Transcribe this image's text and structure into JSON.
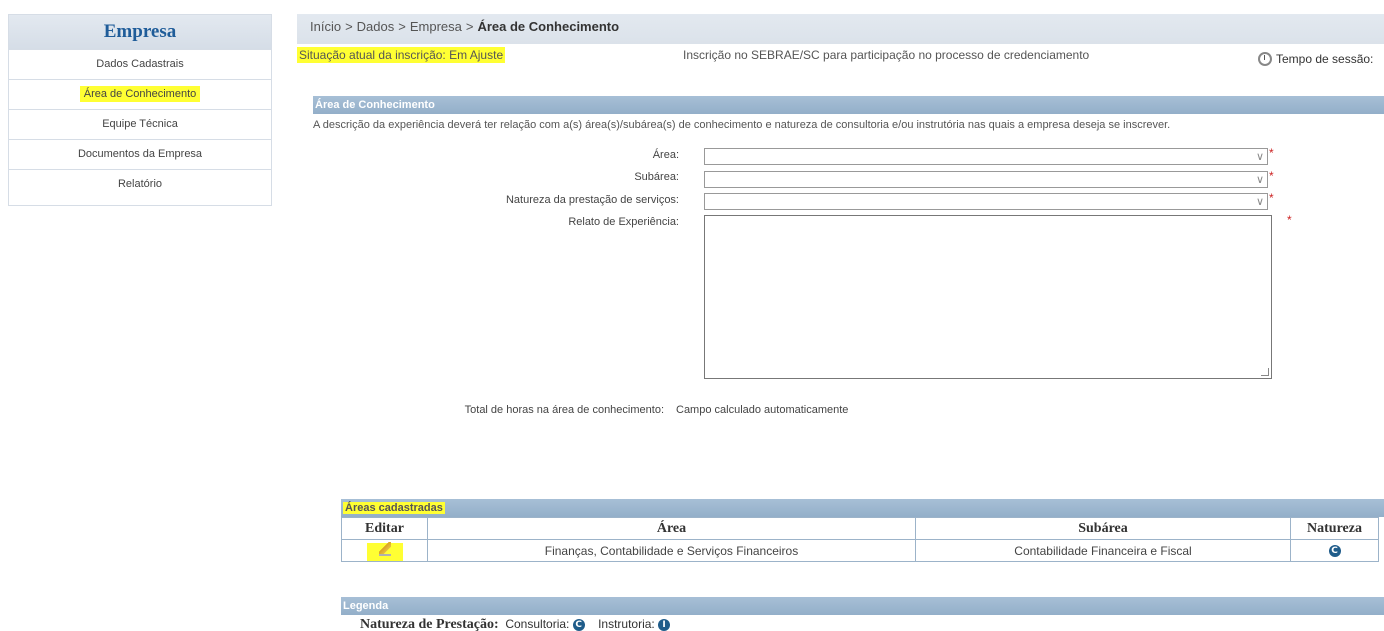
{
  "sidebar": {
    "title": "Empresa",
    "items": [
      {
        "label": "Dados Cadastrais"
      },
      {
        "label": "Área de Conhecimento",
        "active": true
      },
      {
        "label": "Equipe Técnica"
      },
      {
        "label": "Documentos da Empresa"
      },
      {
        "label": "Relatório"
      }
    ]
  },
  "breadcrumb": {
    "items": [
      "Início",
      "Dados",
      "Empresa"
    ],
    "separator": ">",
    "current": "Área de Conhecimento"
  },
  "status": {
    "text": "Situação atual da inscrição: Em Ajuste",
    "subscription": "Inscrição no SEBRAE/SC para participação no processo de credenciamento",
    "session_label": "Tempo de sessão:"
  },
  "section": {
    "title": "Área de Conhecimento",
    "instructions": "A descrição da experiência deverá ter relação com a(s) área(s)/subárea(s) de conhecimento e natureza de consultoria e/ou instrutória nas quais a empresa deseja se inscrever."
  },
  "form": {
    "area_label": "Área:",
    "area_value": "",
    "subarea_label": "Subárea:",
    "subarea_value": "",
    "natureza_label": "Natureza da prestação de serviços:",
    "natureza_value": "",
    "relato_label": "Relato de Experiência:",
    "relato_value": "",
    "required_mark": "*",
    "total_label": "Total de horas na área de conhecimento:",
    "total_value": "Campo calculado automaticamente"
  },
  "registered": {
    "title": "Áreas cadastradas",
    "columns": [
      "Editar",
      "Área",
      "Subárea",
      "Natureza"
    ],
    "rows": [
      {
        "area": "Finanças, Contabilidade e Serviços Financeiros",
        "subarea": "Contabilidade Financeira e Fiscal",
        "natureza": "C"
      }
    ]
  },
  "legend": {
    "title": "Legenda",
    "label": "Natureza de Prestação:",
    "consultoria_label": "Consultoria:",
    "consultoria_badge": "C",
    "instrutoria_label": "Instrutoria:",
    "instrutoria_badge": "I"
  },
  "colors": {
    "highlight": "#ffff33",
    "section_bar": "#9ab4cd",
    "brand_blue": "#1f5c99"
  }
}
